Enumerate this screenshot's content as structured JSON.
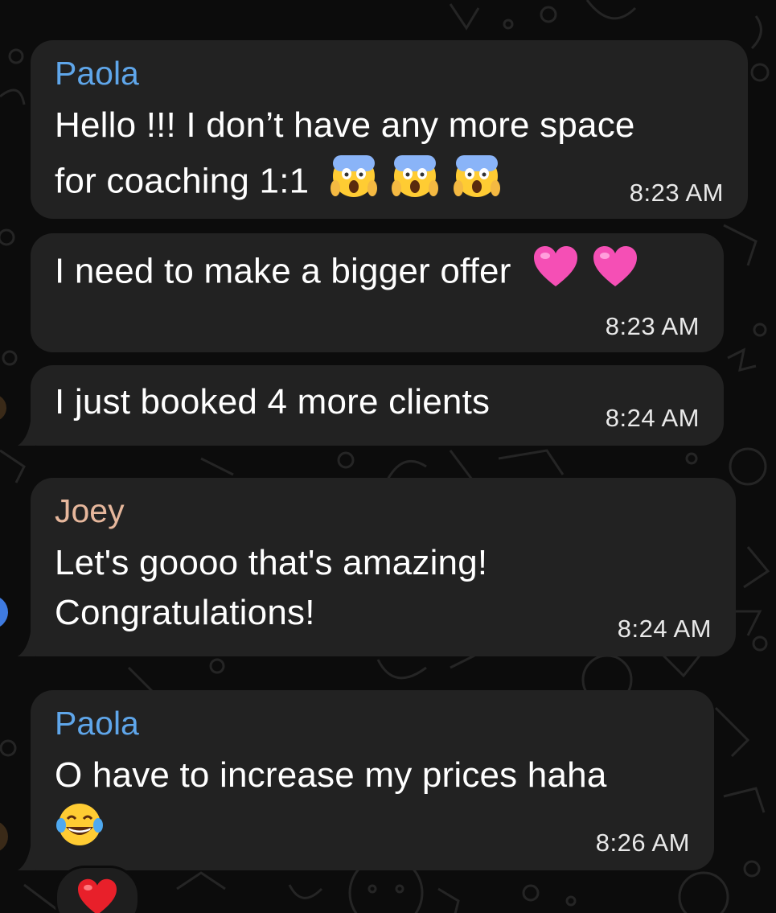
{
  "chat": {
    "messages": [
      {
        "sender": "Paola",
        "sender_color": "#5fa6ea",
        "lines": [
          "Hello !!! I don’t have any more space",
          "for coaching 1:1"
        ],
        "emoji_icon": "face-screaming-in-fear-icon",
        "emoji_count": 3,
        "time": "8:23 AM"
      },
      {
        "sender": "",
        "lines": [
          "I need to make a bigger offer"
        ],
        "emoji_icon": "pink-heart-icon",
        "emoji_count": 2,
        "time": "8:23 AM"
      },
      {
        "sender": "",
        "lines": [
          "I just booked 4 more clients"
        ],
        "time": "8:24 AM"
      },
      {
        "sender": "Joey",
        "sender_color": "#e6b79c",
        "lines": [
          "Let's goooo that's amazing!",
          "Congratulations!"
        ],
        "time": "8:24 AM"
      },
      {
        "sender": "Paola",
        "sender_color": "#5fa6ea",
        "lines": [
          "O have to increase my prices haha"
        ],
        "emoji_icon": "face-with-tears-of-joy-icon",
        "emoji_count": 1,
        "time": "8:26 AM"
      }
    ],
    "reaction": {
      "icon": "red-heart-icon"
    }
  },
  "colors": {
    "background": "#0c0c0c",
    "bubble": "#222222",
    "text": "#ffffff"
  }
}
